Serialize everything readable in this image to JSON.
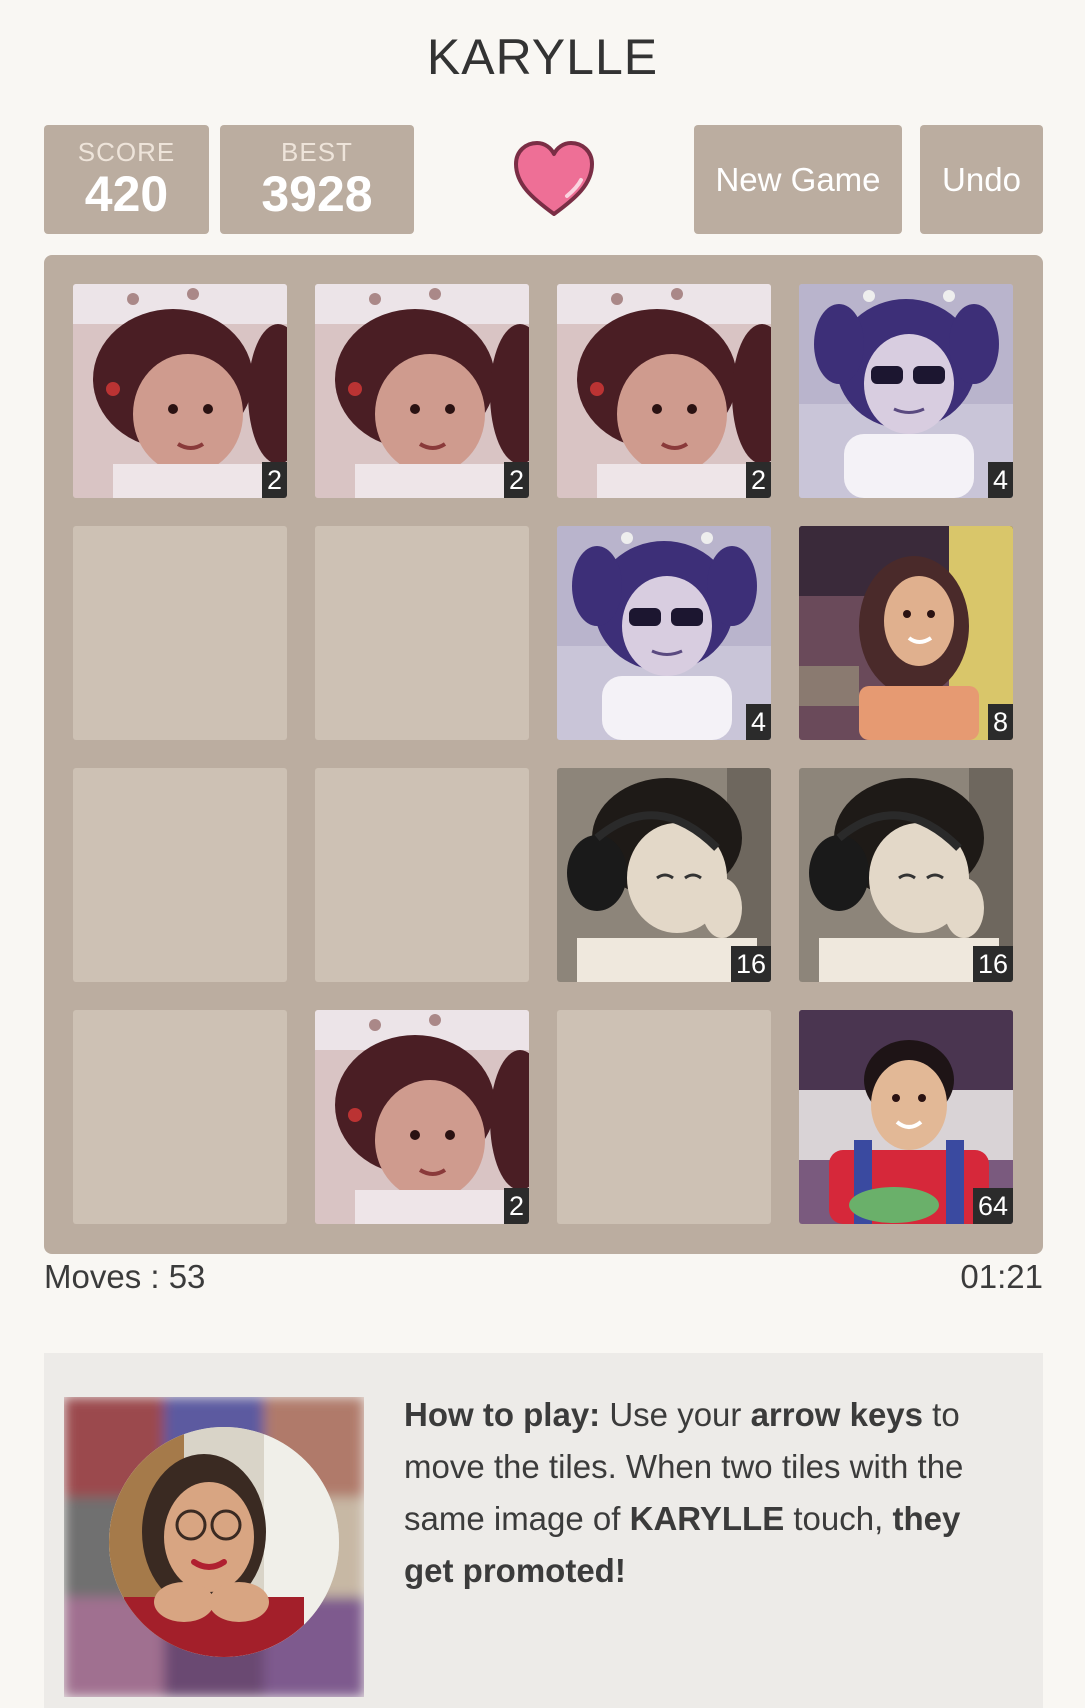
{
  "app": {
    "title": "KARYLLE"
  },
  "score": {
    "label": "SCORE",
    "value": "420"
  },
  "best": {
    "label": "BEST",
    "value": "3928"
  },
  "buttons": {
    "new_game": "New Game",
    "undo": "Undo"
  },
  "board": {
    "rows": [
      [
        2,
        2,
        2,
        4
      ],
      [
        0,
        0,
        4,
        8
      ],
      [
        0,
        0,
        16,
        16
      ],
      [
        0,
        2,
        0,
        64
      ]
    ]
  },
  "status": {
    "moves": "Moves : 53",
    "timer": "01:21"
  },
  "howto": {
    "lead": "How to play:",
    "t1": " Use your ",
    "b1": "arrow keys",
    "t2": " to move the tiles. When two tiles with the same image of ",
    "b2": "KARYLLE",
    "t3": " touch, ",
    "b3": "they get promoted!"
  },
  "colors": {
    "board": "#bbada0",
    "empty_cell": "#cdc1b4",
    "heart": "#ee6f96"
  }
}
